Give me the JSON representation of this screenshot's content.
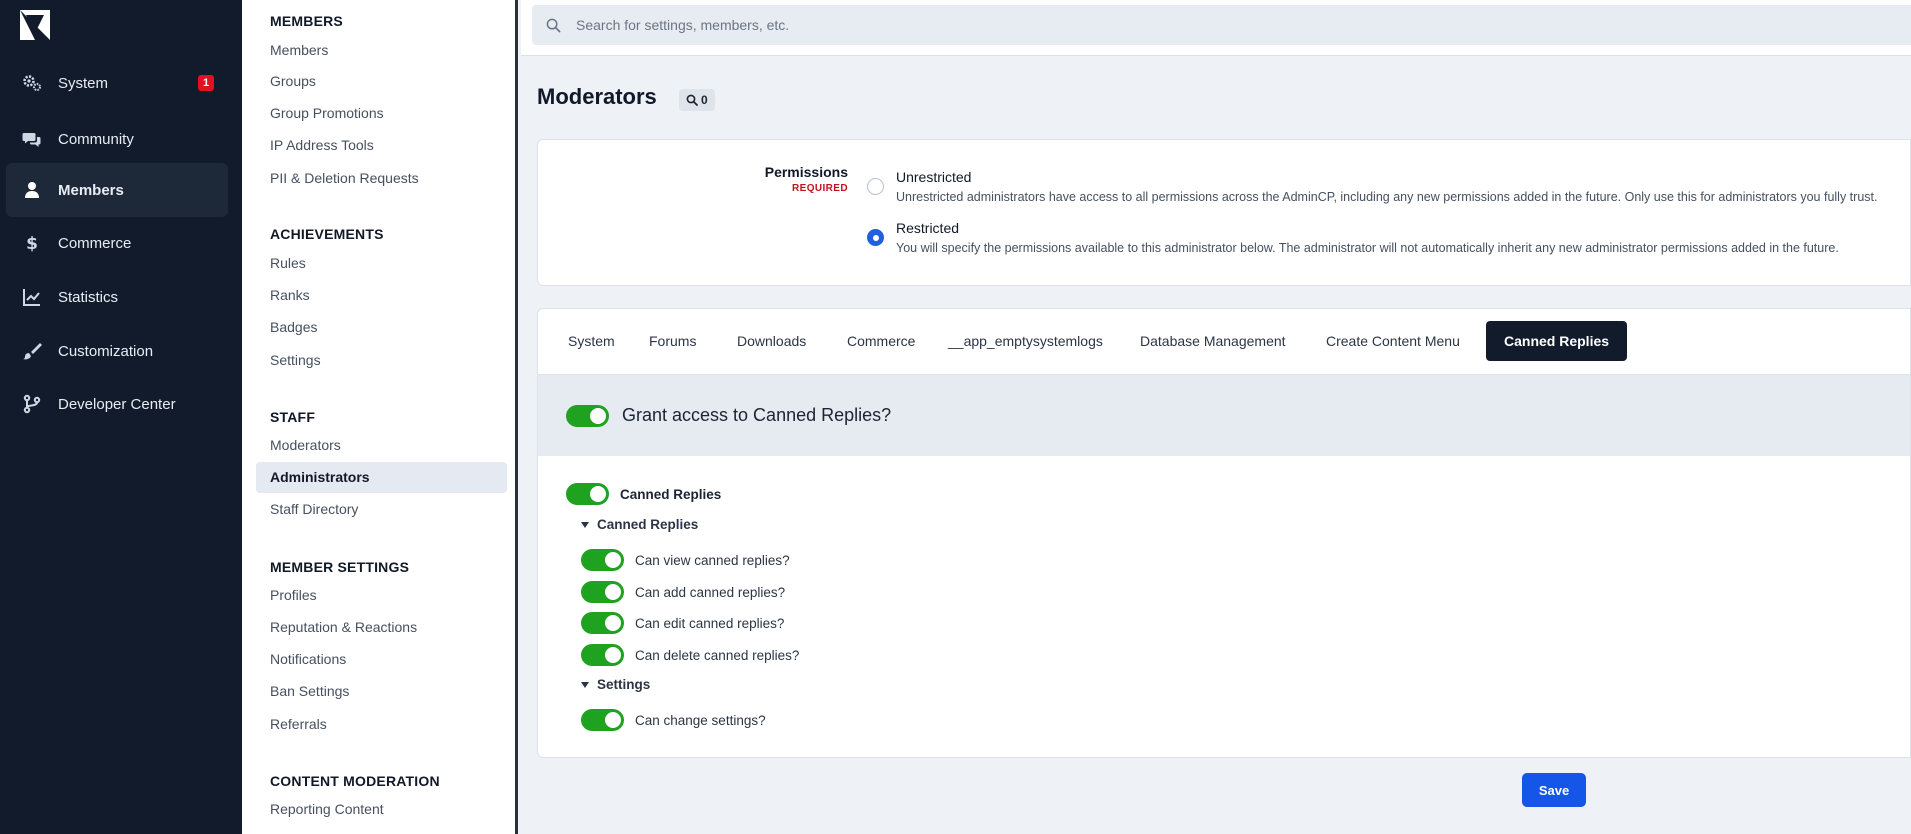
{
  "rail": {
    "items": [
      {
        "label": "System",
        "icon": "gears-icon",
        "badge": "1"
      },
      {
        "label": "Community",
        "icon": "comments-icon"
      },
      {
        "label": "Members",
        "icon": "user-icon",
        "active": true
      },
      {
        "label": "Commerce",
        "icon": "dollar-icon"
      },
      {
        "label": "Statistics",
        "icon": "line-chart-icon"
      },
      {
        "label": "Customization",
        "icon": "brush-icon"
      },
      {
        "label": "Developer Center",
        "icon": "code-branch-icon"
      }
    ]
  },
  "submenu": {
    "sections": [
      {
        "heading": "MEMBERS",
        "items": [
          "Members",
          "Groups",
          "Group Promotions",
          "IP Address Tools",
          "PII & Deletion Requests"
        ]
      },
      {
        "heading": "ACHIEVEMENTS",
        "items": [
          "Rules",
          "Ranks",
          "Badges",
          "Settings"
        ]
      },
      {
        "heading": "STAFF",
        "items": [
          "Moderators",
          "Administrators",
          "Staff Directory"
        ],
        "active_item": "Administrators"
      },
      {
        "heading": "MEMBER SETTINGS",
        "items": [
          "Profiles",
          "Reputation & Reactions",
          "Notifications",
          "Ban Settings",
          "Referrals"
        ]
      },
      {
        "heading": "CONTENT MODERATION",
        "items": [
          "Reporting Content"
        ]
      }
    ]
  },
  "search": {
    "placeholder": "Search for settings, members, etc."
  },
  "page": {
    "title": "Moderators",
    "count": "0"
  },
  "permissions": {
    "label": "Permissions",
    "required": "REQUIRED",
    "options": [
      {
        "title": "Unrestricted",
        "desc": "Unrestricted administrators have access to all permissions across the AdminCP, including any new permissions added in the future. Only use this for administrators you fully trust.",
        "selected": false
      },
      {
        "title": "Restricted",
        "desc": "You will specify the permissions available to this administrator below. The administrator will not automatically inherit any new administrator permissions added in the future.",
        "selected": true
      }
    ]
  },
  "tabs": [
    "System",
    "Forums",
    "Downloads",
    "Commerce",
    "__app_emptysystemlogs",
    "Database Management",
    "Create Content Menu",
    "Canned Replies"
  ],
  "active_tab": "Canned Replies",
  "grant": {
    "label": "Grant access to Canned Replies?",
    "on": true
  },
  "module": {
    "label": "Canned Replies",
    "on": true
  },
  "groups": [
    {
      "label": "Canned Replies",
      "perms": [
        {
          "label": "Can view canned replies?",
          "on": true
        },
        {
          "label": "Can add canned replies?",
          "on": true
        },
        {
          "label": "Can edit canned replies?",
          "on": true
        },
        {
          "label": "Can delete canned replies?",
          "on": true
        }
      ]
    },
    {
      "label": "Settings",
      "perms": [
        {
          "label": "Can change settings?",
          "on": true
        }
      ]
    }
  ],
  "footer": {
    "save_label": "Save"
  },
  "colors": {
    "accent": "#1556e8",
    "toggle_on": "#1fa21f",
    "rail_bg": "#111b2b",
    "badge": "#e3101f"
  }
}
